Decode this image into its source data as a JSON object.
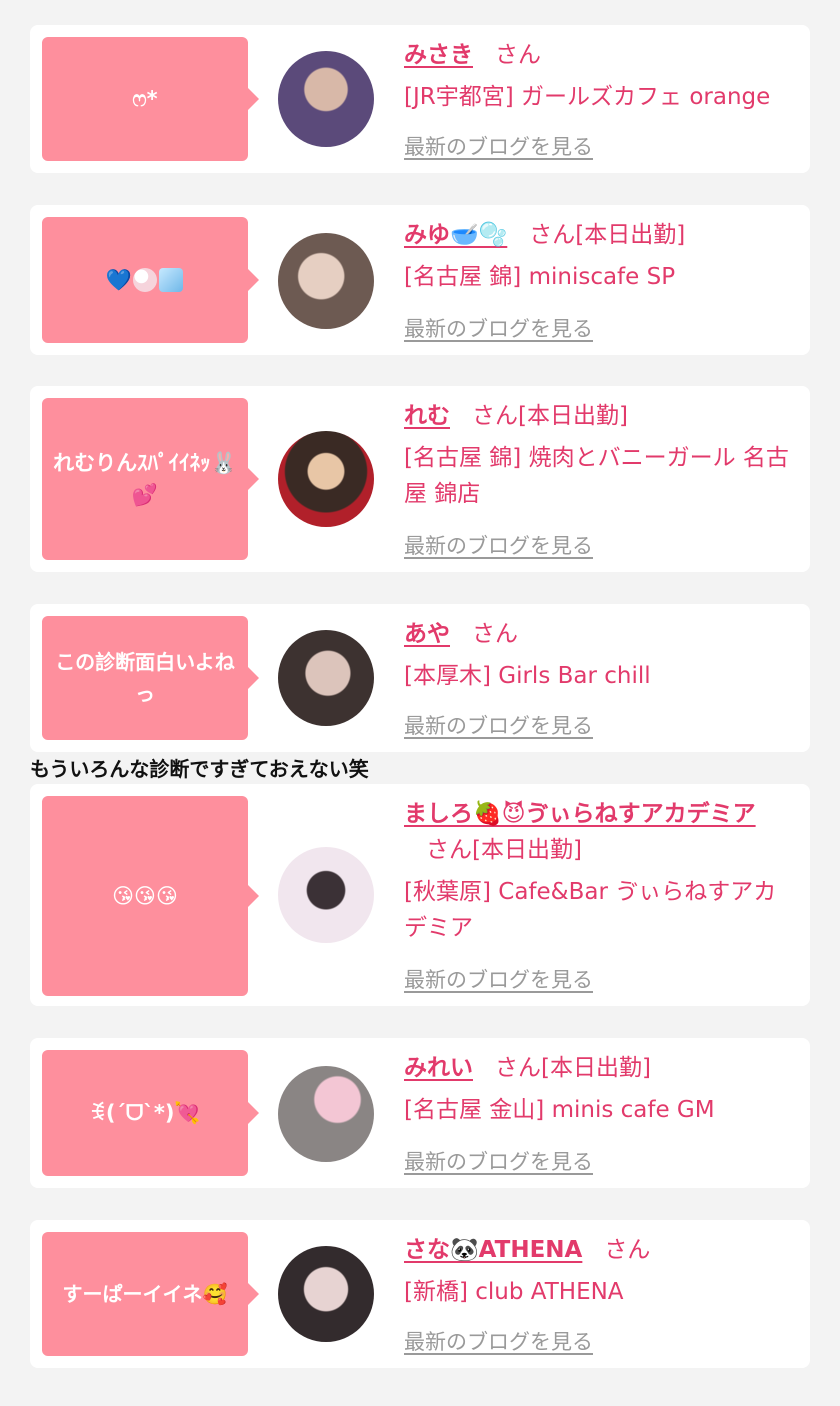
{
  "suffix": "さん",
  "blog_link": "最新のブログを見る",
  "caption": "もういろんな診断ですぎておえない笑",
  "cards": [
    {
      "bubble": "ෆ*",
      "bubble_emojis": [],
      "name": "みさき",
      "status": "",
      "shop": "[JR宇都宮] ガールズカフェ orange",
      "avatar_colors": [
        "#5b4a7a",
        "#d8b8a8"
      ]
    },
    {
      "bubble": "💙 ",
      "bubble_emojis": [
        "bubbles-icon",
        "ice-icon"
      ],
      "name": "みゆ🥣🫧",
      "status": "[本日出勤]",
      "shop": "[名古屋 錦] miniscafe SP",
      "avatar_colors": [
        "#6d5a52",
        "#e6cfc2"
      ]
    },
    {
      "bubble": "れむりんｽﾊﾟｲｲﾈｯ🐰💕",
      "bubble_emojis": [],
      "name": "れむ",
      "status": "[本日出勤]",
      "shop": "[名古屋 錦] 焼肉とバニーガール 名古屋 錦店",
      "avatar_colors": [
        "#b1202a",
        "#3a2a24"
      ]
    },
    {
      "bubble": "この診断面白いよねっ",
      "bubble_emojis": [],
      "name": "あや",
      "status": "",
      "shop": "[本厚木] Girls Bar chill",
      "avatar_colors": [
        "#3d3230",
        "#dcc4bb"
      ]
    },
    {
      "bubble": "😘😘😘",
      "bubble_emojis": [],
      "name": "ましろ🍓😈ゔぃらねすアカデミア",
      "status": "[本日出勤]",
      "shop": "[秋葉原] Cafe&Bar ゔぃらねすアカデミア",
      "avatar_colors": [
        "#f1e6ee",
        "#3b3136"
      ]
    },
    {
      "bubble": "ꉂ(ˊᗜˋ*)💘",
      "bubble_emojis": [],
      "name": "みれい",
      "status": "[本日出勤]",
      "shop": "[名古屋 金山] minis cafe GM",
      "avatar_colors": [
        "#8a8584",
        "#f3c6d4"
      ]
    },
    {
      "bubble": "すーぱーイイネ🥰",
      "bubble_emojis": [],
      "name": "さな🐼ATHENA",
      "status": "",
      "shop": "[新橋] club ATHENA",
      "avatar_colors": [
        "#332b2d",
        "#e7d3d2"
      ]
    }
  ]
}
